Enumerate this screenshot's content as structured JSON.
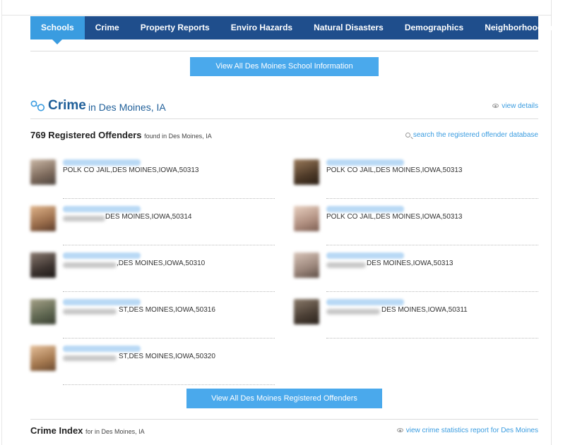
{
  "nav": {
    "tabs": [
      "Schools",
      "Crime",
      "Property Reports",
      "Enviro Hazards",
      "Natural Disasters",
      "Demographics",
      "Neighborhood Info"
    ],
    "active_tab": "Schools"
  },
  "schools": {
    "view_all_button": "View All Des Moines School Information"
  },
  "crime": {
    "title": "Crime",
    "location": "in Des Moines, IA",
    "view_details": "view details",
    "icon": "handcuffs-icon"
  },
  "offenders": {
    "count_title": "769 Registered Offenders",
    "found_text": "found in Des Moines, IA",
    "search_link": "search the registered offender database",
    "items": [
      {
        "address": "POLK CO JAIL,DES MOINES,IOWA,50313"
      },
      {
        "address": "POLK CO JAIL,DES MOINES,IOWA,50313"
      },
      {
        "address": "DES MOINES,IOWA,50314"
      },
      {
        "address": "POLK CO JAIL,DES MOINES,IOWA,50313"
      },
      {
        "address": ",DES MOINES,IOWA,50310"
      },
      {
        "address": "DES MOINES,IOWA,50313"
      },
      {
        "address": "ST,DES MOINES,IOWA,50316"
      },
      {
        "address": "DES MOINES,IOWA,50311"
      },
      {
        "address": "ST,DES MOINES,IOWA,50320"
      }
    ],
    "view_all_button": "View All Des Moines Registered Offenders"
  },
  "crime_index": {
    "title": "Crime Index",
    "subtitle": "for in Des Moines, IA",
    "report_link": "view crime statistics report for Des Moines"
  },
  "colors": {
    "nav_bg": "#1f4e8c",
    "active_tab": "#3a9ce0",
    "button": "#4aa9ec",
    "link": "#3a9ce0",
    "heading_blue": "#1f5f99"
  }
}
